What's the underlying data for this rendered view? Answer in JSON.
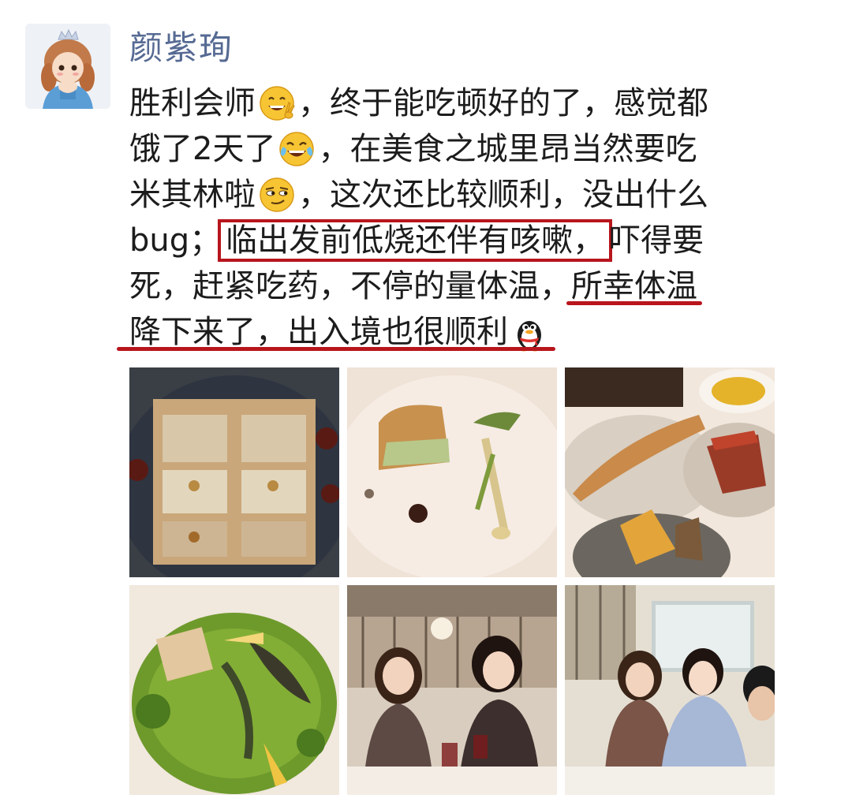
{
  "post": {
    "author": "颜紫珣",
    "lines": [
      {
        "parts": [
          {
            "text": "胜利会师"
          },
          {
            "emoji": "grin-peace-emoji"
          },
          {
            "text": "，终于能吃顿好的了，感觉都"
          }
        ]
      },
      {
        "parts": [
          {
            "text": "饿了2天了"
          },
          {
            "emoji": "tears-of-joy-emoji"
          },
          {
            "text": "，在美食之城里昂当然要吃"
          }
        ]
      },
      {
        "parts": [
          {
            "text": "米其林啦"
          },
          {
            "emoji": "smug-emoji"
          },
          {
            "text": "，这次还比较顺利，没出什么"
          }
        ]
      },
      {
        "parts": [
          {
            "text": "bug；"
          },
          {
            "text": "临出发前低烧还伴有咳嗽，",
            "highlight": "box"
          },
          {
            "text": "吓得要"
          }
        ]
      },
      {
        "parts": [
          {
            "text": "死，赶紧吃药，不停的量体温，"
          },
          {
            "text": "所幸体温",
            "highlight": "underline"
          }
        ]
      },
      {
        "parts": [
          {
            "text": "降下来了，出入境也很顺利",
            "highlight": "underline"
          },
          {
            "emoji": "penguin-emoji"
          }
        ]
      }
    ]
  },
  "photos": [
    {
      "name": "photo-pate-en-croute",
      "kind": "pate"
    },
    {
      "name": "photo-terrine-plate",
      "kind": "terrine"
    },
    {
      "name": "photo-bread-and-meat",
      "kind": "bread"
    },
    {
      "name": "photo-green-dish",
      "kind": "green"
    },
    {
      "name": "photo-two-women-toasting",
      "kind": "people1"
    },
    {
      "name": "photo-group-at-table",
      "kind": "people2"
    }
  ],
  "colors": {
    "username": "#566a93",
    "highlight": "#b8151d",
    "text": "#1c1c1c"
  }
}
